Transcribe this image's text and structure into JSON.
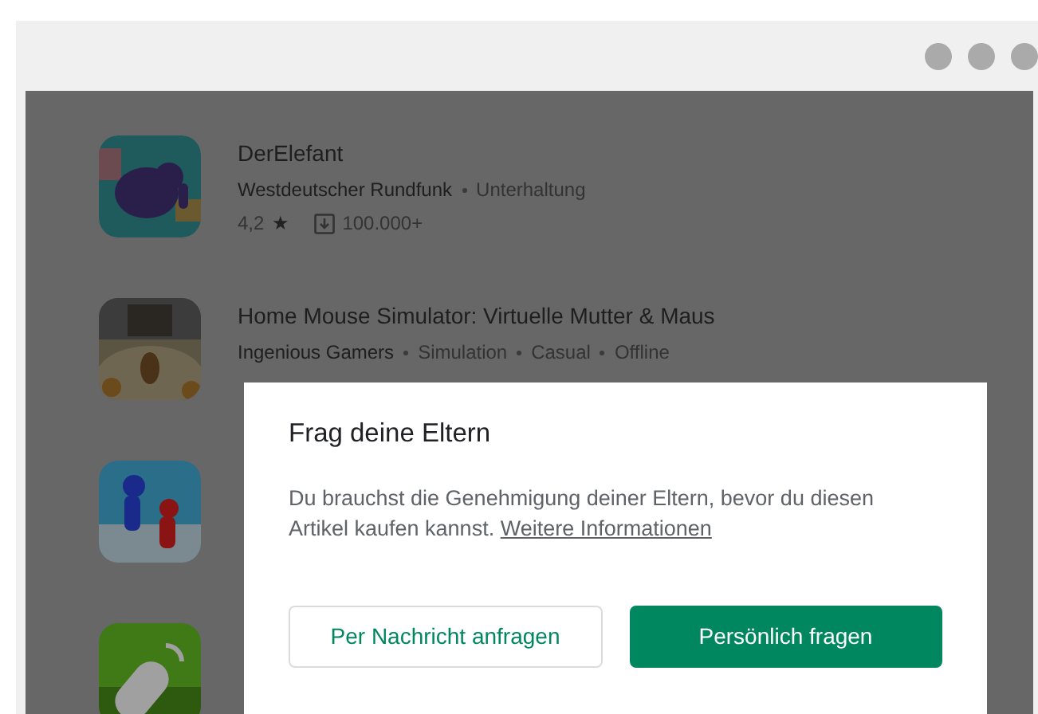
{
  "apps": [
    {
      "kind": "elephant",
      "title": "DerElefant",
      "developer": "Westdeutscher Rundfunk",
      "tags": [
        "Unterhaltung"
      ],
      "rating": "4,2",
      "star": "★",
      "downloads": "100.000+"
    },
    {
      "kind": "mouse",
      "title": "Home Mouse Simulator: Virtuelle Mutter & Maus",
      "developer": "Ingenious Gamers",
      "tags": [
        "Simulation",
        "Casual",
        "Offline"
      ]
    },
    {
      "kind": "runners"
    },
    {
      "kind": "remote"
    }
  ],
  "dialog": {
    "title": "Frag deine Eltern",
    "body": "Du brauchst die Genehmigung deiner Eltern, bevor du diesen Artikel kaufen kannst.",
    "link": "Weitere Informationen",
    "buttons": [
      {
        "label": "Per Nachricht anfragen",
        "primary": false
      },
      {
        "label": "Persönlich fragen",
        "primary": true
      }
    ]
  }
}
